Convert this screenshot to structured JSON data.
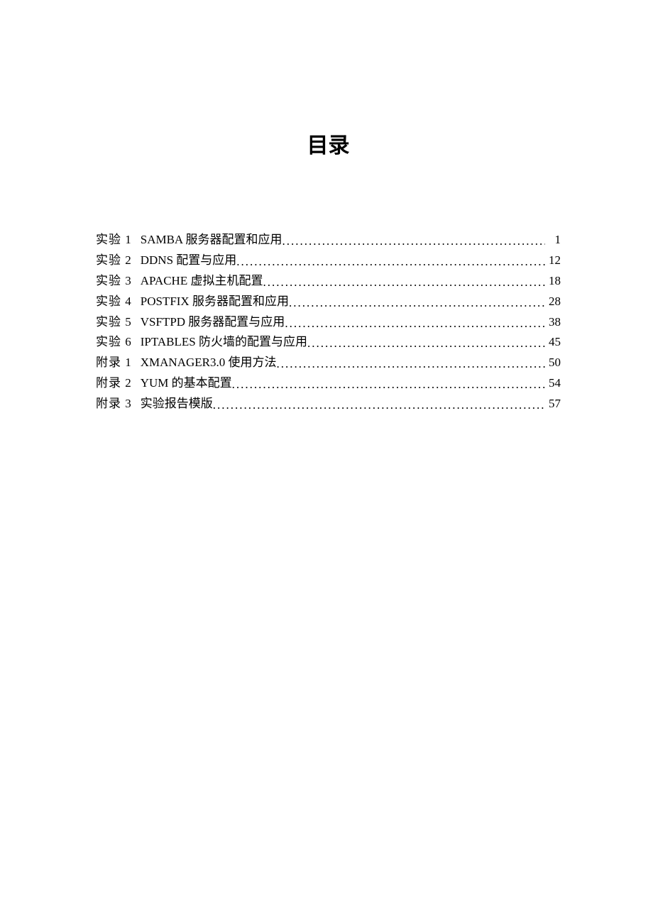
{
  "title": "目录",
  "entries": [
    {
      "label": "实验 1",
      "text": "SAMBA 服务器配置和应用 ",
      "page": "1"
    },
    {
      "label": "实验 2",
      "text": "DDNS 配置与应用",
      "page": "12"
    },
    {
      "label": "实验 3",
      "text": "APACHE 虚拟主机配置 ",
      "page": "18"
    },
    {
      "label": "实验 4",
      "text": "POSTFIX 服务器配置和应用 ",
      "page": "28"
    },
    {
      "label": "实验 5",
      "text": "VSFTPD 服务器配置与应用",
      "page": "38"
    },
    {
      "label": "实验 6",
      "text": "IPTABLES 防火墙的配置与应用 ",
      "page": "45"
    },
    {
      "label": "附录 1",
      "text": "XMANAGER3.0 使用方法 ",
      "page": "50"
    },
    {
      "label": "附录 2",
      "text": "YUM 的基本配置 ",
      "page": "54"
    },
    {
      "label": "附录 3",
      "text": "实验报告模版",
      "page": "57"
    }
  ]
}
